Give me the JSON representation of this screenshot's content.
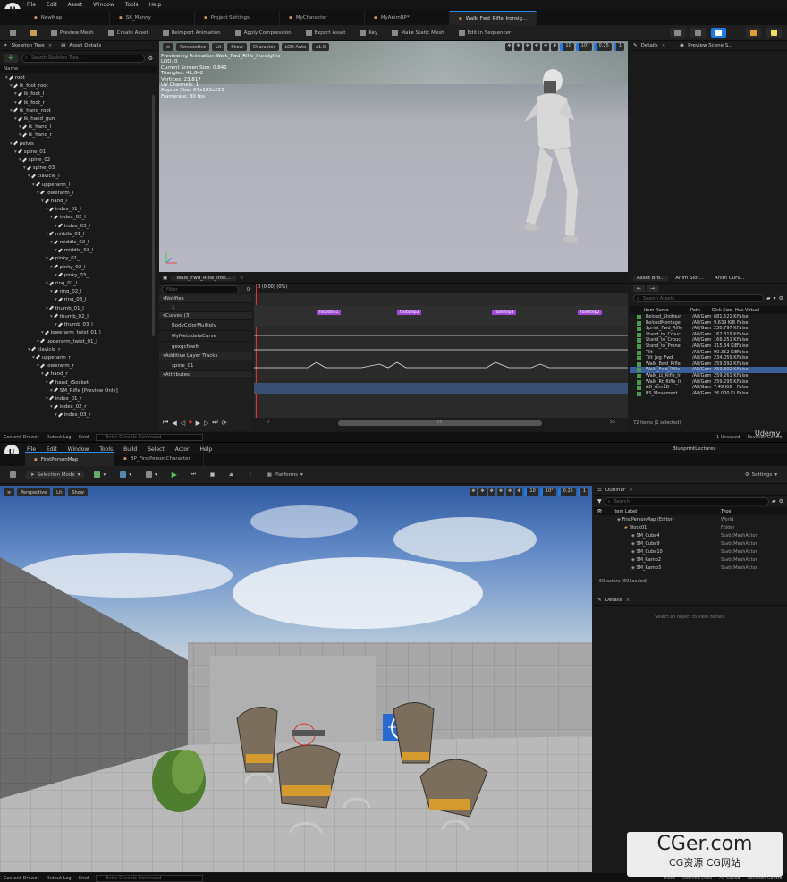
{
  "persona": {
    "menu": [
      "File",
      "Edit",
      "Asset",
      "Window",
      "Tools",
      "Help"
    ],
    "tabs": [
      {
        "label": "NewMap",
        "active": false
      },
      {
        "label": "SK_Manny",
        "active": false
      },
      {
        "label": "Project Settings",
        "active": false
      },
      {
        "label": "MyCharacter",
        "active": false
      },
      {
        "label": "MyAnimBP*",
        "active": false
      },
      {
        "label": "Walk_Fwd_Rifle_Ironsig...",
        "active": true
      }
    ],
    "toolbar": [
      "Preview Mesh",
      "Create Asset",
      "Reimport Animation",
      "Apply Compression",
      "Export Asset",
      "Key",
      "Make Static Mesh",
      "Edit in Sequencer"
    ],
    "skeleton": {
      "tab_label": "Skeleton Tree",
      "tab2_label": "Asset Details",
      "search_placeholder": "Search Skeleton Tree...",
      "col_name": "Name",
      "bones": [
        {
          "n": "root",
          "d": 0
        },
        {
          "n": "ik_foot_root",
          "d": 1
        },
        {
          "n": "ik_foot_l",
          "d": 2
        },
        {
          "n": "ik_foot_r",
          "d": 2
        },
        {
          "n": "ik_hand_root",
          "d": 1
        },
        {
          "n": "ik_hand_gun",
          "d": 2
        },
        {
          "n": "ik_hand_l",
          "d": 3
        },
        {
          "n": "ik_hand_r",
          "d": 3
        },
        {
          "n": "pelvis",
          "d": 1
        },
        {
          "n": "spine_01",
          "d": 2
        },
        {
          "n": "spine_02",
          "d": 3
        },
        {
          "n": "spine_03",
          "d": 4
        },
        {
          "n": "clavicle_l",
          "d": 5
        },
        {
          "n": "upperarm_l",
          "d": 6
        },
        {
          "n": "lowerarm_l",
          "d": 7
        },
        {
          "n": "hand_l",
          "d": 8
        },
        {
          "n": "index_01_l",
          "d": 9
        },
        {
          "n": "index_02_l",
          "d": 10
        },
        {
          "n": "index_03_l",
          "d": 11
        },
        {
          "n": "middle_01_l",
          "d": 9
        },
        {
          "n": "middle_02_l",
          "d": 10
        },
        {
          "n": "middle_03_l",
          "d": 11
        },
        {
          "n": "pinky_01_l",
          "d": 9
        },
        {
          "n": "pinky_02_l",
          "d": 10
        },
        {
          "n": "pinky_03_l",
          "d": 11
        },
        {
          "n": "ring_01_l",
          "d": 9
        },
        {
          "n": "ring_02_l",
          "d": 10
        },
        {
          "n": "ring_03_l",
          "d": 11
        },
        {
          "n": "thumb_01_l",
          "d": 9
        },
        {
          "n": "thumb_02_l",
          "d": 10
        },
        {
          "n": "thumb_03_l",
          "d": 11
        },
        {
          "n": "lowerarm_twist_01_l",
          "d": 8
        },
        {
          "n": "upperarm_twist_01_l",
          "d": 7
        },
        {
          "n": "clavicle_r",
          "d": 5
        },
        {
          "n": "upperarm_r",
          "d": 6
        },
        {
          "n": "lowerarm_r",
          "d": 7
        },
        {
          "n": "hand_r",
          "d": 8
        },
        {
          "n": "hand_rSocket",
          "d": 9
        },
        {
          "n": "SM_Rifle [Preview Only]",
          "d": 10
        },
        {
          "n": "index_01_r",
          "d": 9
        },
        {
          "n": "index_02_r",
          "d": 10
        },
        {
          "n": "index_03_r",
          "d": 11
        }
      ]
    },
    "viewport": {
      "perspective": "Perspective",
      "lit": "Lit",
      "show": "Show",
      "character": "Character",
      "lod": "LOD Auto",
      "speed": "x1.0",
      "overlay": [
        "Previewing Animation Walk_Fwd_Rifle_Ironsights",
        "LOD: 0",
        "Current Screen Size: 0.841",
        "Triangles: 41,042",
        "Vertices: 23,817",
        "UV Channels: 1",
        "Approx Size: 67x183x223",
        "Framerate: 30 fps"
      ],
      "right_nums": [
        "10",
        "10°",
        "0.25",
        "1"
      ]
    },
    "details": {
      "tab": "Details",
      "tab2": "Preview Scene S..."
    },
    "anim": {
      "tab": "Walk_Fwd_Rifle_Iron...",
      "filter_placeholder": "Filter",
      "frame": "0",
      "time": "0 (0.00) (0%)",
      "tracks": [
        "Notifies",
        "1",
        "Curves (3)",
        "BodyColorMultiply",
        "MyMetadataCurve",
        "gexgcfewfr",
        "Additive Layer Tracks",
        "spine_01",
        "Attributes"
      ],
      "notifies": [
        "footstep1",
        "footstep2",
        "footstep3",
        "footstep2"
      ],
      "bottom_nums": [
        "0",
        "55",
        "55"
      ]
    },
    "asset_browser": {
      "tabs": [
        "Asset Bro...",
        "Anim Slot...",
        "Anim Curv..."
      ],
      "search_placeholder": "Search Assets",
      "cols": [
        "Item Name",
        "Path",
        "Disk Size",
        "Has Virtual"
      ],
      "rows": [
        [
          "Reload_Shotgun",
          "/All/Gam",
          "681.521 Ki",
          "False"
        ],
        [
          "ReloadMontage",
          "/All/Gam",
          "9.639 KiB",
          "False"
        ],
        [
          "Sprint_Fwd_Rifle",
          "/All/Gam",
          "230.797 Ki",
          "False"
        ],
        [
          "Stand_to_Crouc",
          "/All/Gam",
          "162.319 Ki",
          "False"
        ],
        [
          "Stand_to_Crouc",
          "/All/Gam",
          "166.251 Ki",
          "False"
        ],
        [
          "Stand_to_Prone",
          "/All/Gam",
          "315.34 KiB",
          "False"
        ],
        [
          "Tilt",
          "/All/Gam",
          "90.352 KiB",
          "False"
        ],
        [
          "Tilt_Jog_Fwd",
          "/All/Gam",
          "234.059 Ki",
          "False"
        ],
        [
          "Walk_Bwd_Rifle",
          "/All/Gam",
          "259.392 Ki",
          "False"
        ],
        [
          "Walk_Fwd_Rifle",
          "/All/Gam",
          "259.392 Ki",
          "False"
        ],
        [
          "Walk_Lt_Rifle_Ir",
          "/All/Gam",
          "259.261 Ki",
          "False"
        ],
        [
          "Walk_Rt_Rifle_Ir",
          "/All/Gam",
          "259.295 Ki",
          "False"
        ],
        [
          "AO_Aim1D",
          "/All/Gam",
          "7.49 KiB",
          "False"
        ],
        [
          "BS_Movement",
          "/All/Gam",
          "26.000 Ki",
          "False"
        ]
      ],
      "selected_index": 9,
      "footer": "72 items (1 selected)"
    },
    "status": {
      "drawer": "Content Drawer",
      "log": "Output Log",
      "cmd": "Cmd",
      "console": "Enter Console Command",
      "unsaved": "1 Unsaved",
      "revision": "Revision Control"
    }
  },
  "level": {
    "menu": [
      "File",
      "Edit",
      "Window",
      "Tools",
      "Build",
      "Select",
      "Actor",
      "Help"
    ],
    "tabs": [
      {
        "label": "FirstPersonMap",
        "active": true
      },
      {
        "label": "BP_FirstPersonCharacter",
        "active": false
      }
    ],
    "project": "BlueprintLectures",
    "selection_mode": "Selection Mode",
    "platforms": "Platforms",
    "settings": "Settings",
    "viewport": {
      "perspective": "Perspective",
      "lit": "Lit",
      "show": "Show",
      "nums": [
        "10",
        "10°",
        "0.25",
        "1"
      ]
    },
    "outliner": {
      "tab": "Outliner",
      "search_placeholder": "Search",
      "col_label": "Item Label",
      "col_type": "Type",
      "rows": [
        {
          "label": "FirstPersonMap (Editor)",
          "type": "World",
          "d": 0
        },
        {
          "label": "Block01",
          "type": "Folder",
          "d": 1
        },
        {
          "label": "SM_Cube4",
          "type": "StaticMeshActor",
          "d": 2
        },
        {
          "label": "SM_Cube9",
          "type": "StaticMeshActor",
          "d": 2
        },
        {
          "label": "SM_Cube10",
          "type": "StaticMeshActor",
          "d": 2
        },
        {
          "label": "SM_Ramp2",
          "type": "StaticMeshActor",
          "d": 2
        },
        {
          "label": "SM_Ramp3",
          "type": "StaticMeshActor",
          "d": 2
        }
      ],
      "footer": "69 actors (69 loaded)"
    },
    "details": {
      "tab": "Details",
      "empty": "Select an object to view details."
    },
    "status": {
      "drawer": "Content Drawer",
      "log": "Output Log",
      "cmd": "Cmd",
      "console": "Enter Console Command",
      "trace": "Trace",
      "derived": "Derived Data",
      "unsaved": "All Saved",
      "revision": "Revision Control"
    }
  },
  "watermark": {
    "udemy": "Udemy",
    "site": "CGer.com",
    "sub": "CG资源 CG网站"
  }
}
